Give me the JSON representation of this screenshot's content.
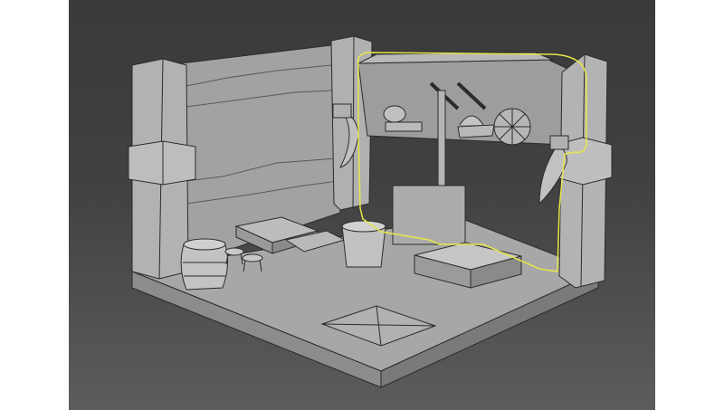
{
  "viewport": {
    "render_mode": "shaded-grey-with-edges",
    "background_top": "#3a3a3a",
    "background_bottom": "#5c5c5c",
    "model_color": "#a9a9a9",
    "edge_color": "#2a2a2a",
    "selection_color": "#e6e64a"
  },
  "scene": {
    "objects": [
      "floor-base",
      "back-wall",
      "left-pillar",
      "back-pillar",
      "right-pillar",
      "shop-booth",
      "barrel",
      "stool-left",
      "stool-right",
      "wooden-crates",
      "bucket",
      "table",
      "horn-left",
      "horn-right",
      "shield-decoration",
      "floor-rug"
    ],
    "selected_object": "shop-booth"
  }
}
